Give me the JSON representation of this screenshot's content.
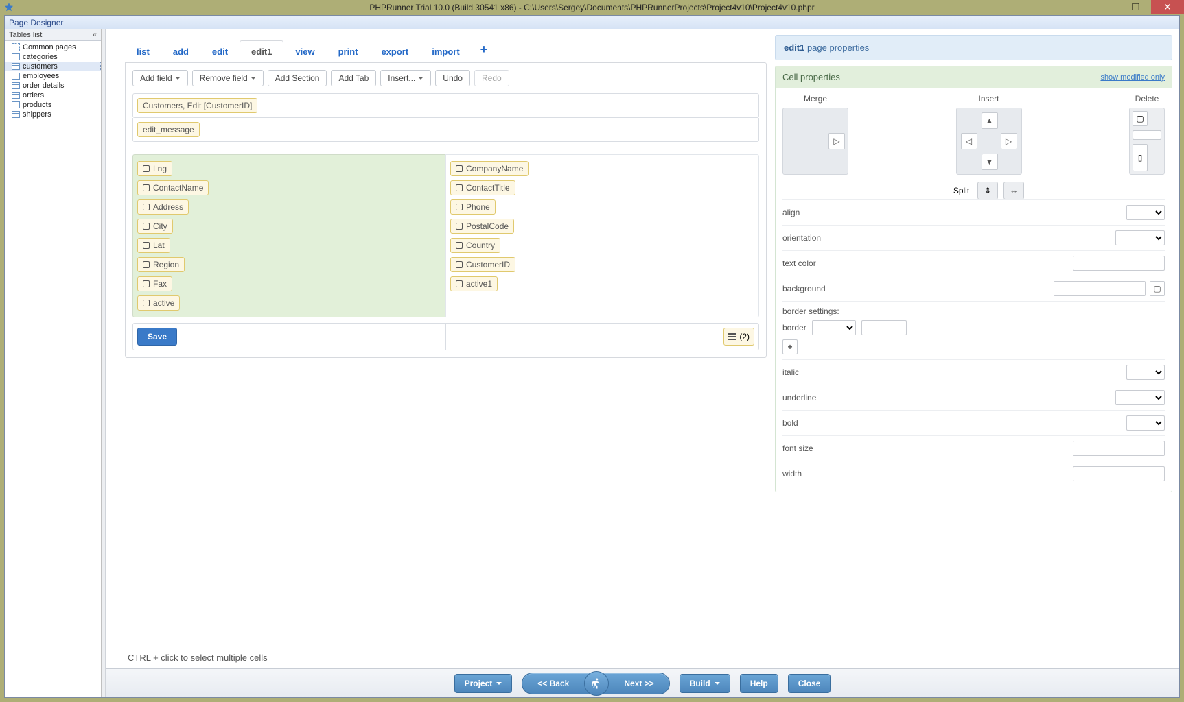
{
  "window": {
    "title": "PHPRunner Trial 10.0 (Build 30541 x86) - C:\\Users\\Sergey\\Documents\\PHPRunnerProjects\\Project4v10\\Project4v10.phpr"
  },
  "ribbon": {
    "tab": "Page Designer"
  },
  "sidebar": {
    "header": "Tables list",
    "items": [
      {
        "label": "Common pages",
        "type": "special"
      },
      {
        "label": "categories",
        "type": "table"
      },
      {
        "label": "customers",
        "type": "table",
        "selected": true
      },
      {
        "label": "employees",
        "type": "table"
      },
      {
        "label": "order details",
        "type": "table"
      },
      {
        "label": "orders",
        "type": "table"
      },
      {
        "label": "products",
        "type": "table"
      },
      {
        "label": "shippers",
        "type": "table"
      }
    ]
  },
  "pageTabs": [
    "list",
    "add",
    "edit",
    "edit1",
    "view",
    "print",
    "export",
    "import"
  ],
  "activePageTab": "edit1",
  "toolbar": {
    "addField": "Add field",
    "removeField": "Remove field",
    "addSection": "Add Section",
    "addTab": "Add Tab",
    "insert": "Insert...",
    "undo": "Undo",
    "redo": "Redo"
  },
  "designer": {
    "breadcrumb": "Customers, Edit [CustomerID]",
    "editMsg": "edit_message",
    "leftFields": [
      "Lng",
      "ContactName",
      "Address",
      "City",
      "Lat",
      "Region",
      "Fax",
      "active"
    ],
    "rightFields": [
      "CompanyName",
      "ContactTitle",
      "Phone",
      "PostalCode",
      "Country",
      "CustomerID",
      "active1"
    ],
    "save": "Save",
    "menuCount": "(2)",
    "hint": "CTRL + click to select multiple cells"
  },
  "props": {
    "titlePrefix": "edit1",
    "titleSuffix": " page properties",
    "cellHeader": "Cell properties",
    "showModified": "show modified only",
    "groups": {
      "merge": "Merge",
      "insert": "Insert",
      "delete": "Delete",
      "split": "Split"
    },
    "rows": {
      "align": "align",
      "orientation": "orientation",
      "textcolor": "text color",
      "background": "background",
      "borderSettings": "border settings:",
      "border": "border",
      "italic": "italic",
      "underline": "underline",
      "bold": "bold",
      "fontsize": "font size",
      "width": "width"
    }
  },
  "footer": {
    "project": "Project",
    "back": "<<  Back",
    "next": "Next  >>",
    "build": "Build",
    "help": "Help",
    "close": "Close"
  }
}
